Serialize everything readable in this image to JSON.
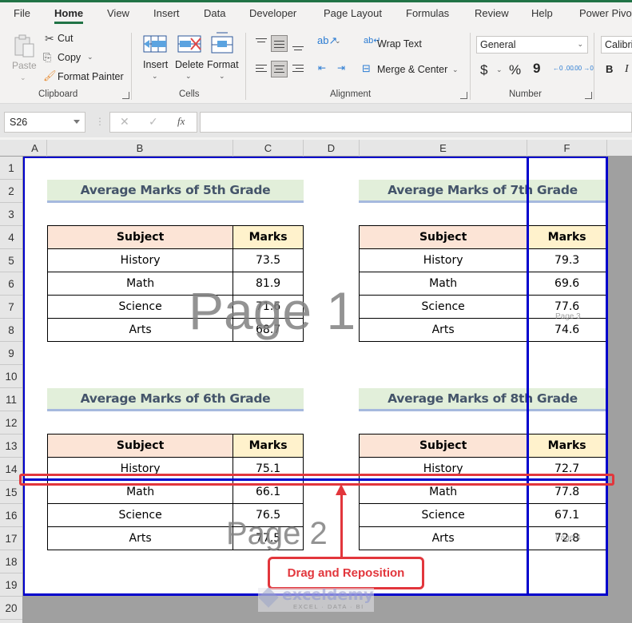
{
  "tabs": [
    {
      "label": "File",
      "active": false
    },
    {
      "label": "Home",
      "active": true
    },
    {
      "label": "View",
      "active": false
    },
    {
      "label": "Insert",
      "active": false
    },
    {
      "label": "Data",
      "active": false
    },
    {
      "label": "Developer",
      "active": false
    },
    {
      "label": "Page Layout",
      "active": false
    },
    {
      "label": "Formulas",
      "active": false
    },
    {
      "label": "Review",
      "active": false
    },
    {
      "label": "Help",
      "active": false
    },
    {
      "label": "Power Pivot",
      "active": false
    }
  ],
  "ribbon": {
    "clipboard": {
      "group_label": "Clipboard",
      "paste": "Paste",
      "cut": "Cut",
      "copy": "Copy",
      "format_painter": "Format Painter"
    },
    "cells": {
      "group_label": "Cells",
      "insert": "Insert",
      "delete": "Delete",
      "format": "Format"
    },
    "alignment": {
      "group_label": "Alignment",
      "wrap_text": "Wrap Text",
      "merge_center": "Merge & Center"
    },
    "number": {
      "group_label": "Number",
      "format_value": "General",
      "currency": "$",
      "percent": "%",
      "comma": "9",
      "increase_decimal": "←0 .00",
      "decrease_decimal": ".00 →0"
    },
    "font": {
      "font_name": "Calibri",
      "bold": "B",
      "italic": "I"
    }
  },
  "formula_bar": {
    "name_box": "S26",
    "cancel": "✕",
    "enter": "✓",
    "fx": "fx",
    "formula": ""
  },
  "columns": [
    "A",
    "B",
    "C",
    "D",
    "E",
    "F"
  ],
  "rows": [
    "1",
    "2",
    "3",
    "4",
    "5",
    "6",
    "7",
    "8",
    "9",
    "10",
    "11",
    "12",
    "13",
    "14",
    "15",
    "16",
    "17",
    "18",
    "19",
    "20"
  ],
  "tables": [
    {
      "title": "Average Marks of 5th Grade",
      "headers": [
        "Subject",
        "Marks"
      ],
      "rows": [
        [
          "History",
          "73.5"
        ],
        [
          "Math",
          "81.9"
        ],
        [
          "Science",
          "71.6"
        ],
        [
          "Arts",
          "68.7"
        ]
      ]
    },
    {
      "title": "Average Marks of 7th Grade",
      "headers": [
        "Subject",
        "Marks"
      ],
      "rows": [
        [
          "History",
          "79.3"
        ],
        [
          "Math",
          "69.6"
        ],
        [
          "Science",
          "77.6"
        ],
        [
          "Arts",
          "74.6"
        ]
      ]
    },
    {
      "title": "Average Marks of 6th Grade",
      "headers": [
        "Subject",
        "Marks"
      ],
      "rows": [
        [
          "History",
          "75.1"
        ],
        [
          "Math",
          "66.1"
        ],
        [
          "Science",
          "76.5"
        ],
        [
          "Arts",
          "77.5"
        ]
      ]
    },
    {
      "title": "Average Marks of 8th Grade",
      "headers": [
        "Subject",
        "Marks"
      ],
      "rows": [
        [
          "History",
          "72.7"
        ],
        [
          "Math",
          "77.8"
        ],
        [
          "Science",
          "67.1"
        ],
        [
          "Arts",
          "72.8"
        ]
      ]
    }
  ],
  "page_labels": {
    "page1": "Page 1",
    "page2": "Page 2",
    "page3": "Page 3",
    "page4": "Page 4"
  },
  "annotation": {
    "callout": "Drag and Reposition",
    "color": "#e2363c"
  },
  "page_break_color": "#0000cc",
  "watermark": {
    "name": "exceldemy",
    "tagline": "EXCEL · DATA · BI"
  }
}
